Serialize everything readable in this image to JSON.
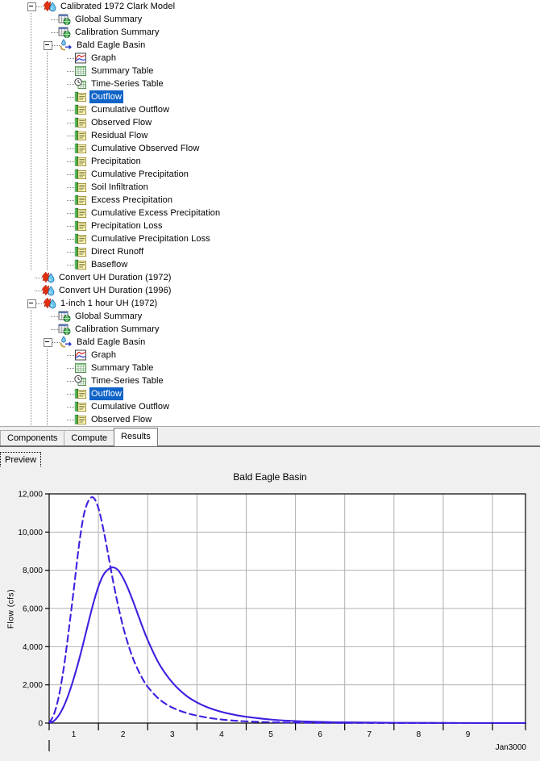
{
  "tree": {
    "items": [
      {
        "label": "Calibrated 1972 Clark Model",
        "depth": 0,
        "icon": "run-icon",
        "expander": "minus",
        "selected": false
      },
      {
        "label": "Global Summary",
        "depth": 1,
        "icon": "globe-table-icon",
        "expander": "none",
        "selected": false
      },
      {
        "label": "Calibration Summary",
        "depth": 1,
        "icon": "globe-table-icon",
        "expander": "none",
        "selected": false
      },
      {
        "label": "Bald Eagle Basin",
        "depth": 1,
        "icon": "basin-outlet-icon",
        "expander": "minus",
        "selected": false
      },
      {
        "label": "Graph",
        "depth": 2,
        "icon": "graph-icon",
        "expander": "none",
        "selected": false
      },
      {
        "label": "Summary Table",
        "depth": 2,
        "icon": "summary-table-icon",
        "expander": "none",
        "selected": false
      },
      {
        "label": "Time-Series Table",
        "depth": 2,
        "icon": "time-series-table-icon",
        "expander": "none",
        "selected": false
      },
      {
        "label": "Outflow",
        "depth": 2,
        "icon": "time-series-icon",
        "expander": "none",
        "selected": true
      },
      {
        "label": "Cumulative Outflow",
        "depth": 2,
        "icon": "time-series-icon",
        "expander": "none",
        "selected": false
      },
      {
        "label": "Observed Flow",
        "depth": 2,
        "icon": "time-series-icon",
        "expander": "none",
        "selected": false
      },
      {
        "label": "Residual Flow",
        "depth": 2,
        "icon": "time-series-icon",
        "expander": "none",
        "selected": false
      },
      {
        "label": "Cumulative Observed Flow",
        "depth": 2,
        "icon": "time-series-icon",
        "expander": "none",
        "selected": false
      },
      {
        "label": "Precipitation",
        "depth": 2,
        "icon": "time-series-icon",
        "expander": "none",
        "selected": false
      },
      {
        "label": "Cumulative Precipitation",
        "depth": 2,
        "icon": "time-series-icon",
        "expander": "none",
        "selected": false
      },
      {
        "label": "Soil Infiltration",
        "depth": 2,
        "icon": "time-series-icon",
        "expander": "none",
        "selected": false
      },
      {
        "label": "Excess Precipitation",
        "depth": 2,
        "icon": "time-series-icon",
        "expander": "none",
        "selected": false
      },
      {
        "label": "Cumulative Excess Precipitation",
        "depth": 2,
        "icon": "time-series-icon",
        "expander": "none",
        "selected": false
      },
      {
        "label": "Precipitation Loss",
        "depth": 2,
        "icon": "time-series-icon",
        "expander": "none",
        "selected": false
      },
      {
        "label": "Cumulative Precipitation Loss",
        "depth": 2,
        "icon": "time-series-icon",
        "expander": "none",
        "selected": false
      },
      {
        "label": "Direct Runoff",
        "depth": 2,
        "icon": "time-series-icon",
        "expander": "none",
        "selected": false
      },
      {
        "label": "Baseflow",
        "depth": 2,
        "icon": "time-series-icon",
        "expander": "none",
        "selected": false
      },
      {
        "label": "Convert UH Duration (1972)",
        "depth": 0,
        "icon": "run-icon",
        "expander": "none",
        "selected": false
      },
      {
        "label": "Convert UH Duration (1996)",
        "depth": 0,
        "icon": "run-icon",
        "expander": "none",
        "selected": false
      },
      {
        "label": "1-inch 1 hour UH (1972)",
        "depth": 0,
        "icon": "run-icon",
        "expander": "minus",
        "selected": false
      },
      {
        "label": "Global Summary",
        "depth": 1,
        "icon": "globe-table-icon",
        "expander": "none",
        "selected": false
      },
      {
        "label": "Calibration Summary",
        "depth": 1,
        "icon": "globe-table-icon",
        "expander": "none",
        "selected": false
      },
      {
        "label": "Bald Eagle Basin",
        "depth": 1,
        "icon": "basin-outlet-icon",
        "expander": "minus",
        "selected": false
      },
      {
        "label": "Graph",
        "depth": 2,
        "icon": "graph-icon",
        "expander": "none",
        "selected": false
      },
      {
        "label": "Summary Table",
        "depth": 2,
        "icon": "summary-table-icon",
        "expander": "none",
        "selected": false
      },
      {
        "label": "Time-Series Table",
        "depth": 2,
        "icon": "time-series-table-icon",
        "expander": "none",
        "selected": false
      },
      {
        "label": "Outflow",
        "depth": 2,
        "icon": "time-series-icon",
        "expander": "none",
        "selected": true
      },
      {
        "label": "Cumulative Outflow",
        "depth": 2,
        "icon": "time-series-icon",
        "expander": "none",
        "selected": false
      },
      {
        "label": "Observed Flow",
        "depth": 2,
        "icon": "time-series-icon",
        "expander": "none",
        "selected": false
      }
    ]
  },
  "tabs": {
    "items": [
      {
        "label": "Components",
        "active": false
      },
      {
        "label": "Compute",
        "active": false
      },
      {
        "label": "Results",
        "active": true
      }
    ]
  },
  "preview": {
    "tab_label": "Preview"
  },
  "colors": {
    "selection": "#1064C8",
    "series": "#4020E0",
    "grid": "#b0b0b0",
    "axis": "#000000",
    "panel": "#f0f0f0"
  },
  "chart_data": {
    "type": "line",
    "title": "Bald Eagle Basin",
    "xlabel": "",
    "ylabel": "Flow (cfs)",
    "x_axis_corner_label": "Jan3000",
    "xlim": [
      0,
      9.67
    ],
    "ylim": [
      0,
      12000
    ],
    "yticks": [
      0,
      2000,
      4000,
      6000,
      8000,
      10000,
      12000
    ],
    "ytick_labels": [
      "0",
      "2,000",
      "4,000",
      "6,000",
      "8,000",
      "10,000",
      "12,000"
    ],
    "xticks": [
      0,
      1,
      2,
      3,
      4,
      5,
      6,
      7,
      8,
      9
    ],
    "xtick_labels": [
      "1",
      "2",
      "3",
      "4",
      "5",
      "6",
      "7",
      "8",
      "9"
    ],
    "grid": true,
    "legend_position": "none",
    "series": [
      {
        "name": "1-inch 1 hour UH (1972) Outflow",
        "style": "dashed",
        "color": "#4020E0",
        "peak_x": 0.9,
        "peak_y": 11800,
        "x": [
          0.0,
          0.1,
          0.2,
          0.3,
          0.4,
          0.5,
          0.6,
          0.7,
          0.8,
          0.9,
          1.0,
          1.1,
          1.2,
          1.3,
          1.4,
          1.5,
          1.6,
          1.7,
          1.8,
          1.9,
          2.0,
          2.2,
          2.4,
          2.6,
          2.8,
          3.0,
          3.2,
          3.4,
          3.6,
          3.8,
          4.0,
          4.5,
          5.0,
          5.5,
          6.0,
          7.0,
          8.0,
          9.0,
          9.67
        ],
        "y": [
          0,
          480,
          1450,
          2950,
          4900,
          7000,
          9200,
          10850,
          11650,
          11800,
          11250,
          10150,
          8800,
          7400,
          6150,
          5050,
          4150,
          3400,
          2800,
          2300,
          1900,
          1330,
          950,
          700,
          520,
          390,
          290,
          215,
          160,
          120,
          90,
          45,
          22,
          12,
          7,
          3,
          1,
          0,
          0
        ]
      },
      {
        "name": "Calibrated 1972 Clark Model Outflow",
        "style": "solid",
        "color": "#4020E0",
        "peak_x": 1.35,
        "peak_y": 8150,
        "x": [
          0.0,
          0.1,
          0.2,
          0.3,
          0.4,
          0.5,
          0.6,
          0.7,
          0.8,
          0.9,
          1.0,
          1.1,
          1.2,
          1.3,
          1.4,
          1.5,
          1.6,
          1.7,
          1.8,
          1.9,
          2.0,
          2.2,
          2.4,
          2.6,
          2.8,
          3.0,
          3.2,
          3.4,
          3.6,
          3.8,
          4.0,
          4.5,
          5.0,
          5.5,
          6.0,
          7.0,
          8.0,
          9.0,
          9.67
        ],
        "y": [
          0,
          120,
          420,
          900,
          1550,
          2350,
          3250,
          4250,
          5300,
          6300,
          7150,
          7750,
          8050,
          8150,
          8000,
          7600,
          7050,
          6400,
          5700,
          5000,
          4350,
          3250,
          2450,
          1850,
          1400,
          1080,
          840,
          660,
          520,
          415,
          330,
          185,
          105,
          62,
          38,
          16,
          7,
          3,
          2
        ]
      }
    ]
  }
}
